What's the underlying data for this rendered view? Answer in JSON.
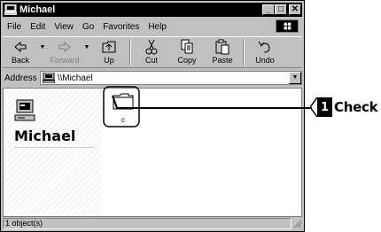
{
  "window": {
    "title": "Michael",
    "title_icon": "computer-icon",
    "buttons": {
      "minimize": "_",
      "maximize": "□",
      "close": "✕"
    }
  },
  "menubar": {
    "items": [
      {
        "label": "File"
      },
      {
        "label": "Edit"
      },
      {
        "label": "View"
      },
      {
        "label": "Go"
      },
      {
        "label": "Favorites"
      },
      {
        "label": "Help"
      }
    ],
    "logo": "windows-logo-icon"
  },
  "toolbar": {
    "buttons": [
      {
        "label": "Back",
        "icon": "back-arrow-icon",
        "enabled": true
      },
      {
        "label": "Forward",
        "icon": "forward-arrow-icon",
        "enabled": false
      },
      {
        "label": "Up",
        "icon": "up-folder-icon",
        "enabled": true
      },
      {
        "label": "Cut",
        "icon": "scissors-icon",
        "enabled": true
      },
      {
        "label": "Copy",
        "icon": "copy-icon",
        "enabled": true
      },
      {
        "label": "Paste",
        "icon": "paste-icon",
        "enabled": true
      },
      {
        "label": "Undo",
        "icon": "undo-icon",
        "enabled": true
      }
    ]
  },
  "address": {
    "label": "Address",
    "value": "\\\\Michael",
    "icon": "computer-icon"
  },
  "content": {
    "computer_name": "Michael",
    "computer_icon": "computer-icon",
    "items": [
      {
        "label": "c",
        "icon": "folder-icon"
      }
    ]
  },
  "status": {
    "text": "1 object(s)"
  },
  "callout": {
    "number": "1",
    "text": "Check"
  },
  "colors": {
    "window_face": "#c0c0c0",
    "title_bar": "#000000",
    "content_bg": "#ffffff"
  }
}
